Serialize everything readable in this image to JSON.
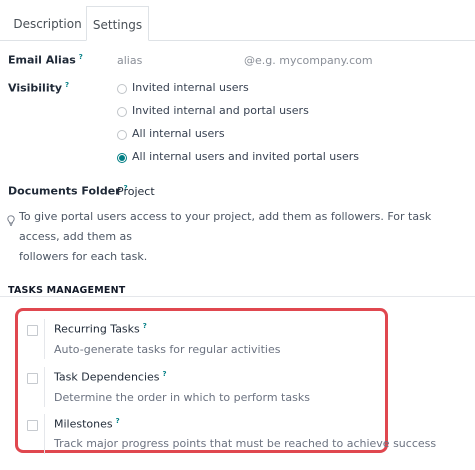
{
  "tabs": [
    {
      "label": "Description",
      "active": false
    },
    {
      "label": "Settings",
      "active": true
    }
  ],
  "email_alias": {
    "label": "Email Alias",
    "help": "?",
    "placeholder": "alias",
    "domain_placeholder": "@e.g. mycompany.com"
  },
  "visibility": {
    "label": "Visibility",
    "help": "?",
    "options": [
      {
        "label": "Invited internal users",
        "selected": false
      },
      {
        "label": "Invited internal and portal users",
        "selected": false
      },
      {
        "label": "All internal users",
        "selected": false
      },
      {
        "label": "All internal users and invited portal users",
        "selected": true
      }
    ]
  },
  "documents_folder": {
    "label": "Documents Folder",
    "help": "?",
    "value": "Project"
  },
  "hint": {
    "icon": "lightbulb-icon",
    "line1": "To give portal users access to your project, add them as followers. For task access, add them as",
    "line2": "followers for each task."
  },
  "tasks_management": {
    "title": "TASKS MANAGEMENT",
    "items": [
      {
        "title": "Recurring Tasks",
        "help": "?",
        "description": "Auto-generate tasks for regular activities",
        "checked": false
      },
      {
        "title": "Task Dependencies",
        "help": "?",
        "description": "Determine the order in which to perform tasks",
        "checked": false
      },
      {
        "title": "Milestones",
        "help": "?",
        "description": "Track major progress points that must be reached to achieve success",
        "checked": false
      }
    ]
  },
  "colors": {
    "accent": "#017e84",
    "highlight": "#e0474f"
  }
}
